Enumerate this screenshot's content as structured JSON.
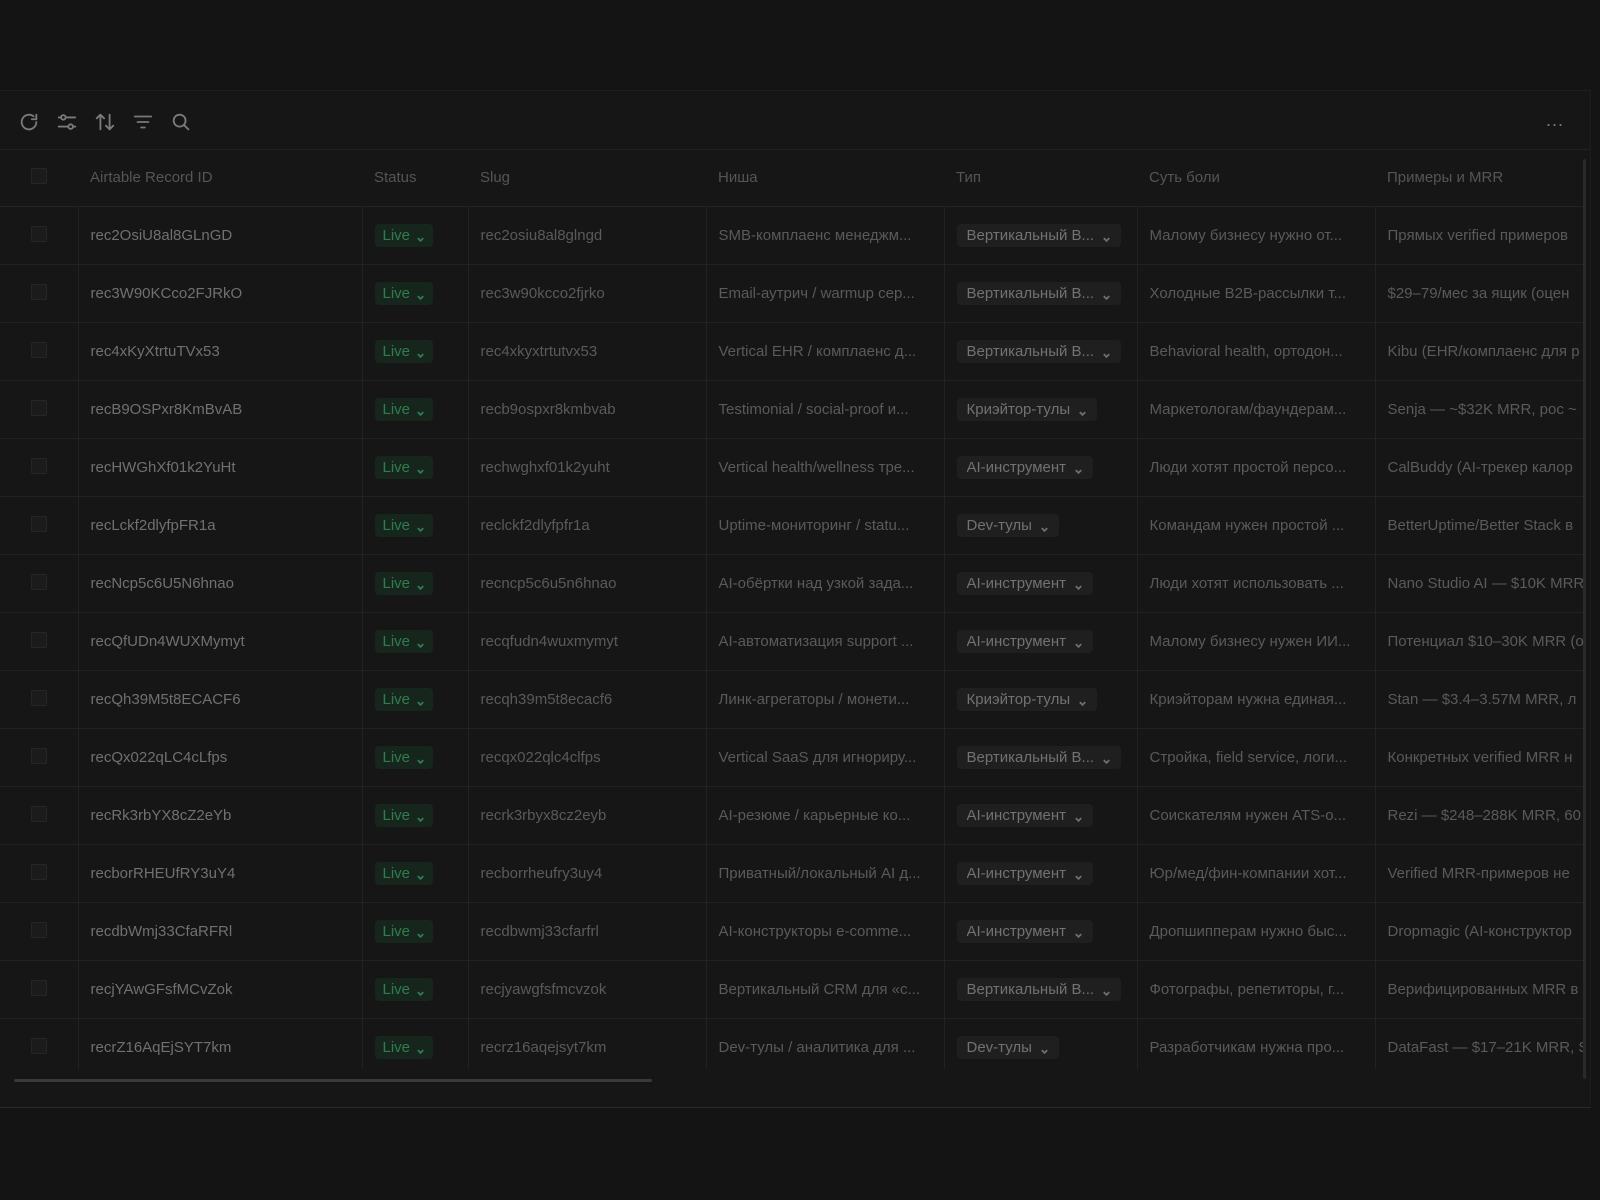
{
  "toolbar": {
    "icons": [
      "refresh-icon",
      "sliders-icon",
      "sort-icon",
      "filter-icon",
      "search-icon"
    ],
    "more_label": "..."
  },
  "table": {
    "columns": [
      "Airtable Record ID",
      "Status",
      "Slug",
      "Ниша",
      "Тип",
      "Суть боли",
      "Примеры и MRR"
    ],
    "rows": [
      {
        "id": "rec2OsiU8al8GLnGD",
        "status": "Live",
        "slug": "rec2osiu8al8glngd",
        "niche": "SMB-комплаенс менеджм...",
        "type": "Вертикальный В...",
        "pain": "Малому бизнесу нужно от...",
        "mrr": "Прямых verified примеров"
      },
      {
        "id": "rec3W90KCco2FJRkO",
        "status": "Live",
        "slug": "rec3w90kcco2fjrko",
        "niche": "Email-аутрич / warmup сер...",
        "type": "Вертикальный В...",
        "pain": "Холодные B2B-рассылки т...",
        "mrr": "$29–79/мес за ящик (оцен"
      },
      {
        "id": "rec4xKyXtrtuTVx53",
        "status": "Live",
        "slug": "rec4xkyxtrtutvx53",
        "niche": "Vertical EHR / комплаенс д...",
        "type": "Вертикальный В...",
        "pain": "Behavioral health, ортодон...",
        "mrr": "Kibu (EHR/комплаенс для р"
      },
      {
        "id": "recB9OSPxr8KmBvAB",
        "status": "Live",
        "slug": "recb9ospxr8kmbvab",
        "niche": "Testimonial / social-proof и...",
        "type": "Криэйтор-тулы",
        "pain": "Маркетологам/фаундерам...",
        "mrr": "Senja — ~$32K MRR, рос ~"
      },
      {
        "id": "recHWGhXf01k2YuHt",
        "status": "Live",
        "slug": "rechwghxf01k2yuht",
        "niche": "Vertical health/wellness тре...",
        "type": "AI-инструмент",
        "pain": "Люди хотят простой персо...",
        "mrr": "CalBuddy (AI-трекер калор"
      },
      {
        "id": "recLckf2dlyfpFR1a",
        "status": "Live",
        "slug": "reclckf2dlyfpfr1a",
        "niche": "Uptime-мониторинг / statu...",
        "type": "Dev-тулы",
        "pain": "Командам нужен простой ...",
        "mrr": "BetterUptime/Better Stack в"
      },
      {
        "id": "recNcp5c6U5N6hnao",
        "status": "Live",
        "slug": "recncp5c6u5n6hnao",
        "niche": "AI-обёртки над узкой зада...",
        "type": "AI-инструмент",
        "pain": "Люди хотят использовать ...",
        "mrr": "Nano Studio AI — $10K MRR"
      },
      {
        "id": "recQfUDn4WUXMymyt",
        "status": "Live",
        "slug": "recqfudn4wuxmymyt",
        "niche": "AI-автоматизация support ...",
        "type": "AI-инструмент",
        "pain": "Малому бизнесу нужен ИИ...",
        "mrr": "Потенциал $10–30K MRR (о"
      },
      {
        "id": "recQh39M5t8ECACF6",
        "status": "Live",
        "slug": "recqh39m5t8ecacf6",
        "niche": "Линк-агрегаторы / монети...",
        "type": "Криэйтор-тулы",
        "pain": "Криэйторам нужна единая...",
        "mrr": "Stan — $3.4–3.57M MRR, л"
      },
      {
        "id": "recQx022qLC4cLfps",
        "status": "Live",
        "slug": "recqx022qlc4clfps",
        "niche": "Vertical SaaS для игнориру...",
        "type": "Вертикальный В...",
        "pain": "Стройка, field service, логи...",
        "mrr": "Конкретных verified MRR н"
      },
      {
        "id": "recRk3rbYX8cZ2eYb",
        "status": "Live",
        "slug": "recrk3rbyx8cz2eyb",
        "niche": "AI-резюме / карьерные ко...",
        "type": "AI-инструмент",
        "pain": "Соискателям нужен ATS-о...",
        "mrr": "Rezi — $248–288K MRR, 60"
      },
      {
        "id": "recborRHEUfRY3uY4",
        "status": "Live",
        "slug": "recborrheufry3uy4",
        "niche": "Приватный/локальный AI д...",
        "type": "AI-инструмент",
        "pain": "Юр/мед/фин-компании хот...",
        "mrr": "Verified MRR-примеров не"
      },
      {
        "id": "recdbWmj33CfaRFRl",
        "status": "Live",
        "slug": "recdbwmj33cfarfrl",
        "niche": "AI-конструкторы e-comme...",
        "type": "AI-инструмент",
        "pain": "Дропшипперам нужно быс...",
        "mrr": "Dropmagic (AI-конструктор"
      },
      {
        "id": "recjYAwGFsfMCvZok",
        "status": "Live",
        "slug": "recjyawgfsfmcvzok",
        "niche": "Вертикальный CRM для «с...",
        "type": "Вертикальный В...",
        "pain": "Фотографы, репетиторы, г...",
        "mrr": "Верифицированных MRR в"
      },
      {
        "id": "recrZ16AqEjSYT7km",
        "status": "Live",
        "slug": "recrz16aqejsyt7km",
        "niche": "Dev-тулы / аналитика для ...",
        "type": "Dev-тулы",
        "pain": "Разработчикам нужна про...",
        "mrr": "DataFast — $17–21K MRR, S"
      }
    ]
  },
  "colors": {
    "background": "#141414",
    "live_text": "#2f7d4f",
    "live_bg": "#17261d"
  }
}
